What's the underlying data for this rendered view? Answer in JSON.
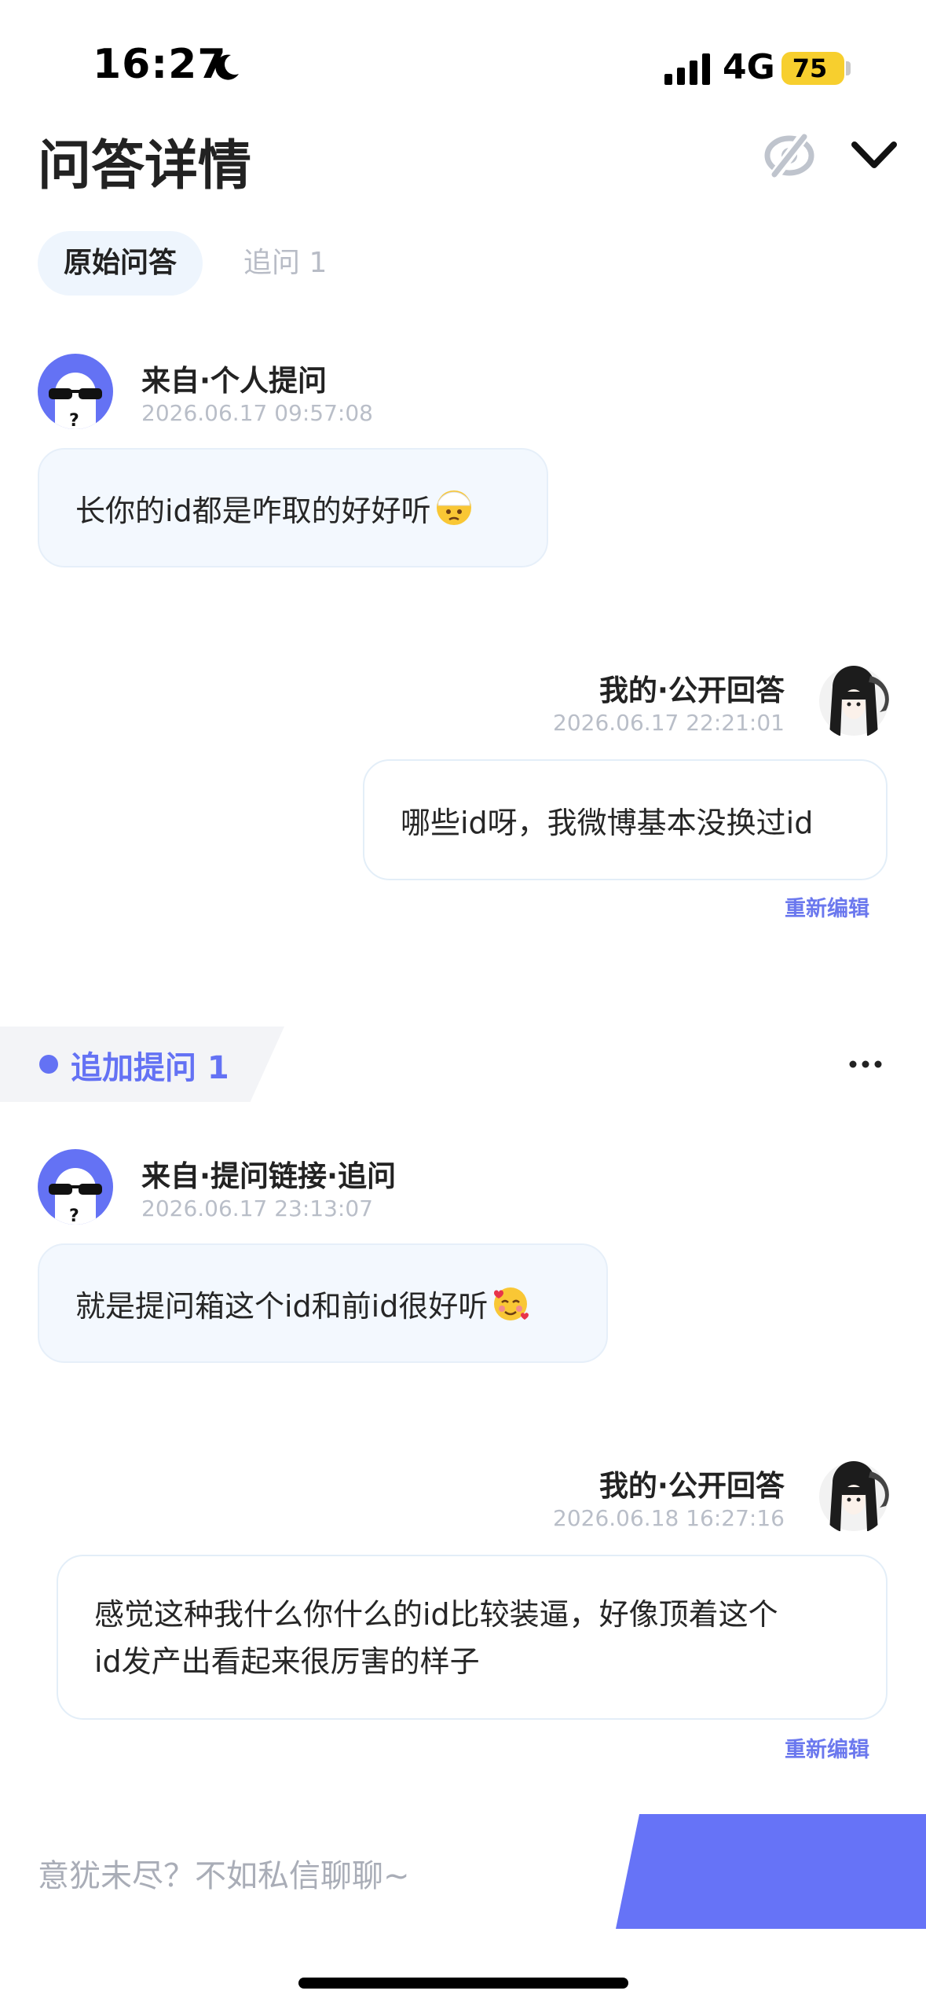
{
  "status_bar": {
    "time": "16:27",
    "network": "4G",
    "battery": "75",
    "icons": [
      "moon-icon",
      "signal-icon",
      "battery-icon"
    ]
  },
  "header": {
    "title": "问答详情",
    "icons": [
      "eye-off-icon",
      "chevron-down-icon"
    ]
  },
  "tabs": [
    {
      "label": "原始问答",
      "active": true
    },
    {
      "label": "追问 1",
      "active": false
    }
  ],
  "original": {
    "question": {
      "source": "来自·个人提问",
      "time": "2026.06.17 09:57:08",
      "text": "长你的id都是咋取的好好听",
      "emoji": "face-with-head-bandage-emoji"
    },
    "answer": {
      "source": "我的·公开回答",
      "time": "2026.06.17 22:21:01",
      "text": "哪些id呀，我微博基本没换过id",
      "reedit": "重新编辑"
    }
  },
  "followup": {
    "label": "追加提问 1",
    "more_icon": "more-icon",
    "question": {
      "source": "来自·提问链接·追问",
      "time": "2026.06.17 23:13:07",
      "text": "就是提问箱这个id和前id很好听",
      "emoji": "smiling-face-with-hearts-emoji"
    },
    "answer": {
      "source": "我的·公开回答",
      "time": "2026.06.18 16:27:16",
      "text_line1": "感觉这种我什么你什么的id比较装逼，好像顶着这个",
      "text_line2": "id发产出看起来很厉害的样子",
      "reedit": "重新编辑"
    }
  },
  "bottom": {
    "input_placeholder": "意犹未尽？不如私信聊聊~"
  },
  "colors": {
    "accent": "#6472f4",
    "bubble_question": "#f3f8fe",
    "time_gray": "#b9bec8"
  }
}
